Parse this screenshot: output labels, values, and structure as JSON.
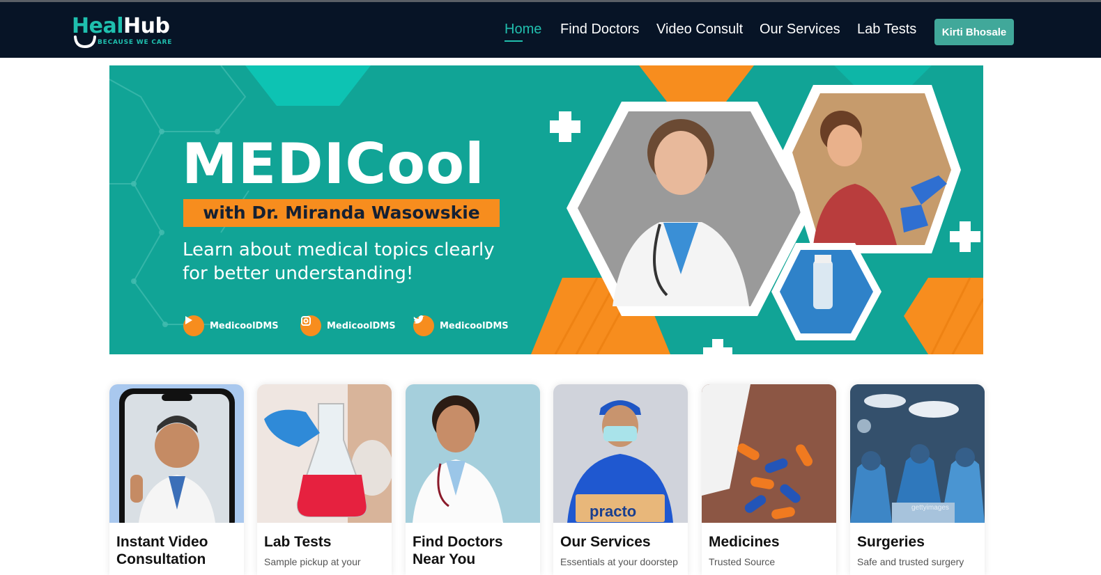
{
  "brand": {
    "name_part1": "Heal",
    "name_part2": "Hub",
    "tagline": "BECAUSE WE CARE"
  },
  "nav": {
    "items": [
      {
        "label": "Home",
        "active": true
      },
      {
        "label": "Find Doctors"
      },
      {
        "label": "Video Consult"
      },
      {
        "label": "Our Services"
      },
      {
        "label": "Lab Tests"
      }
    ],
    "user_button": "Kirti Bhosale"
  },
  "banner": {
    "title": "MEDICool",
    "subtitle": "with Dr. Miranda Wasowskie",
    "description": "Learn about medical topics clearly for better understanding!",
    "socials": [
      {
        "icon": "youtube-icon",
        "handle": "MedicoolDMS"
      },
      {
        "icon": "instagram-icon",
        "handle": "MedicoolDMS"
      },
      {
        "icon": "twitter-icon",
        "handle": "MedicoolDMS"
      }
    ],
    "colors": {
      "teal": "#11a496",
      "orange": "#f78d1e"
    }
  },
  "cards": [
    {
      "title": "Instant Video Consultation",
      "desc": ""
    },
    {
      "title": "Lab Tests",
      "desc": "Sample pickup at your"
    },
    {
      "title": "Find Doctors Near You",
      "desc": ""
    },
    {
      "title": "Our Services",
      "desc": "Essentials at your doorstep"
    },
    {
      "title": "Medicines",
      "desc": "Trusted Source"
    },
    {
      "title": "Surgeries",
      "desc": "Safe and trusted surgery"
    }
  ],
  "card_image_text": {
    "practo_box": "practo",
    "watermark": "gettyimages"
  },
  "colors": {
    "navbar": "#071426",
    "accent": "#21bfae",
    "user_button": "#41a89a"
  }
}
